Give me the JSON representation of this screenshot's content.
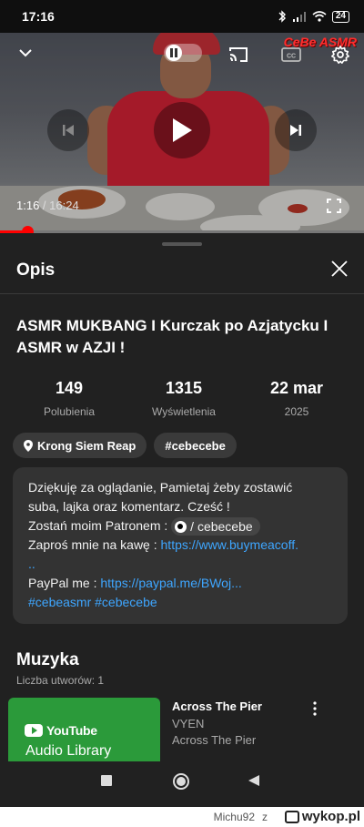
{
  "status_bar": {
    "time": "17:16",
    "battery": "24"
  },
  "player": {
    "watermark": "CeBe ASMR",
    "current_time": "1:16",
    "separator": " / ",
    "duration": "16:24",
    "progress": 0.077,
    "accent_color": "#ff0000"
  },
  "description_panel": {
    "title": "Opis",
    "video_title": "ASMR MUKBANG I Kurczak po Azjatycku I ASMR w AZJI !",
    "stats": [
      {
        "value": "149",
        "label": "Polubienia"
      },
      {
        "value": "1315",
        "label": "Wyświetlenia"
      },
      {
        "value": "22 mar",
        "label": "2025"
      }
    ],
    "chips": {
      "location": "Krong Siem Reap",
      "hashtag": "#cebecebe"
    },
    "description": {
      "line1": "Dziękuję za oglądanie, Pamietaj żeby zostawić",
      "line2": "suba, lajka oraz komentarz. Cześć !",
      "patron_prefix": "Zostań moim Patronem : ",
      "patron_chip": " / cebecebe",
      "coffee_prefix": "Zaproś mnie na kawę : ",
      "coffee_link": "https://www.buymeacoff.",
      "coffee_link_cont": "..",
      "paypal_prefix": "PayPal me : ",
      "paypal_link": "https://paypal.me/BWoj...",
      "hashtags": "#cebeasmr #cebecebe"
    },
    "music": {
      "heading": "Muzyka",
      "count": "Liczba utworów: 1",
      "thumb_brand": "YouTube",
      "thumb_subtitle": "Audio Library",
      "track_title": "Across The Pier",
      "track_artist": "VYEN",
      "track_album": "Across The Pier"
    }
  },
  "footer": {
    "username": "Michu92",
    "separator": "z",
    "site": "wykop.pl"
  },
  "icons": [
    "chevron-down-icon",
    "pause-icon",
    "cast-icon",
    "captions-icon",
    "gear-icon",
    "previous-icon",
    "play-icon",
    "next-icon",
    "fullscreen-icon",
    "close-icon",
    "location-pin-icon",
    "more-vert-icon",
    "square-icon",
    "circle-icon",
    "back-triangle-icon"
  ]
}
